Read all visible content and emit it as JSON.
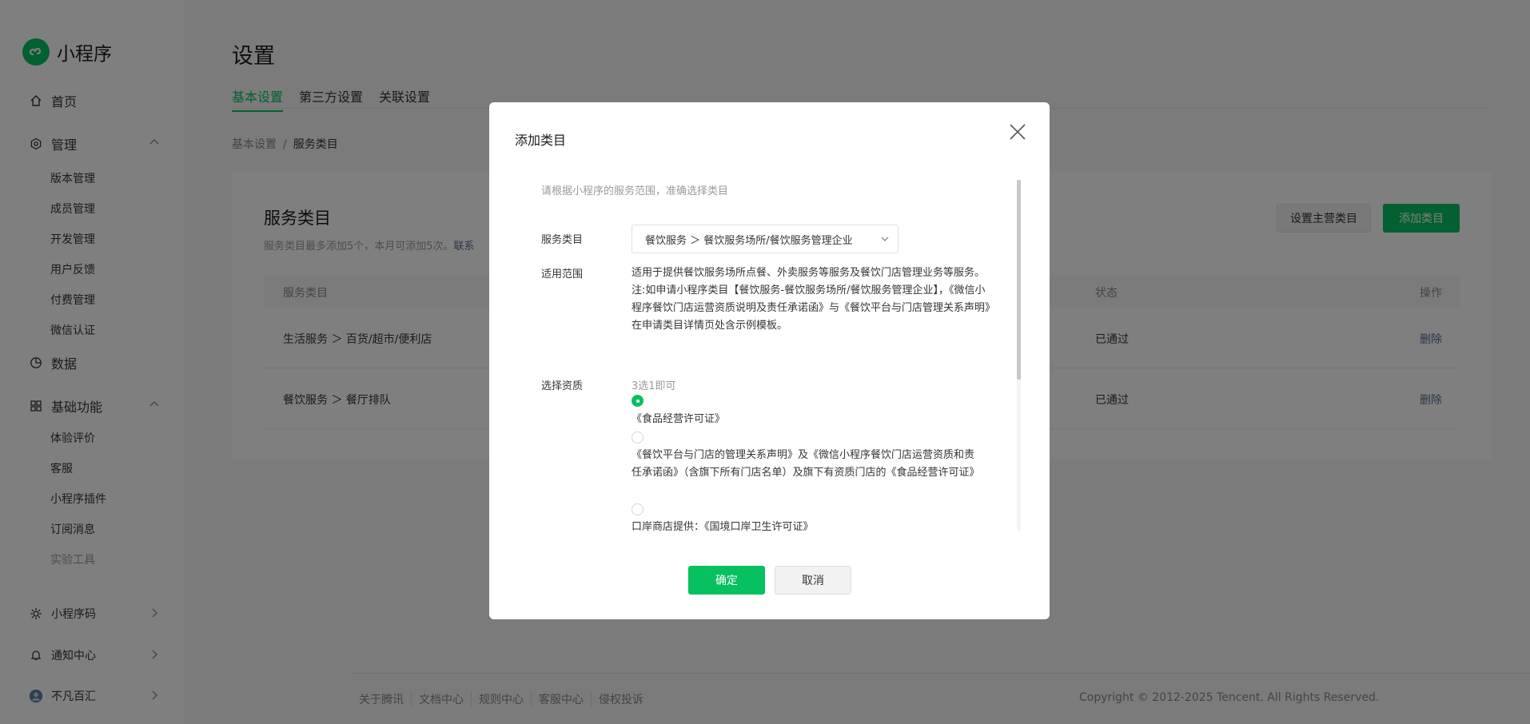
{
  "sidebar": {
    "logo_text": "小程序",
    "nav": {
      "home": "首页",
      "manage": "管理",
      "manage_items": [
        "版本管理",
        "成员管理",
        "开发管理",
        "用户反馈",
        "付费管理",
        "微信认证"
      ],
      "data": "数据",
      "basic": "基础功能",
      "basic_items": [
        "体验评价",
        "客服",
        "小程序插件",
        "订阅消息",
        "实验工具"
      ],
      "qrcode": "小程序码",
      "notify": "通知中心",
      "account": "不凡百汇"
    }
  },
  "header": {
    "title": "设置",
    "tabs": [
      "基本设置",
      "第三方设置",
      "关联设置"
    ],
    "breadcrumb": [
      "基本设置",
      "/",
      "服务类目"
    ]
  },
  "card": {
    "title": "服务类目",
    "subtitle": "服务类目最多添加5个，本月可添加5次。",
    "subtitle_link": "联系",
    "btn_set_main": "设置主营类目",
    "btn_add": "添加类目",
    "columns": [
      "服务类目",
      "状态",
      "操作"
    ],
    "rows": [
      {
        "category": "生活服务 ＞ 百货/超市/便利店",
        "status": "已通过",
        "action": "删除"
      },
      {
        "category": "餐饮服务 ＞ 餐厅排队",
        "status": "已通过",
        "action": "删除"
      }
    ]
  },
  "footer": {
    "links": [
      "关于腾讯",
      "文档中心",
      "规则中心",
      "客服中心",
      "侵权投诉"
    ],
    "copyright": "Copyright © 2012-2025 Tencent. All Rights Reserved."
  },
  "dialog": {
    "title": "添加类目",
    "hint": "请根据小程序的服务范围，准确选择类目",
    "label_category": "服务类目",
    "selected_category": "餐饮服务 ＞ 餐饮服务场所/餐饮服务管理企业",
    "label_scope": "适用范围",
    "scope_text_1": "适用于提供餐饮服务场所点餐、外卖服务等服务及餐饮门店管理业务等服务。",
    "scope_text_2": "注:如申请小程序类目【餐饮服务-餐饮服务场所/餐饮服务管理企业】，《微信小程序餐饮门店运营资质说明及责任承诺函》与《餐饮平台与门店管理关系声明》在申请类目详情页处含示例模板。",
    "label_qual": "选择资质",
    "qual_hint": "3选1即可",
    "options": [
      "《食品经营许可证》",
      "《餐饮平台与门店的管理关系声明》及《微信小程序餐饮门店运营资质和责任承诺函》（含旗下所有门店名单）及旗下有资质门店的《食品经营许可证》",
      "口岸商店提供：《国境口岸卫生许可证》"
    ],
    "ok": "确定",
    "cancel": "取消"
  }
}
